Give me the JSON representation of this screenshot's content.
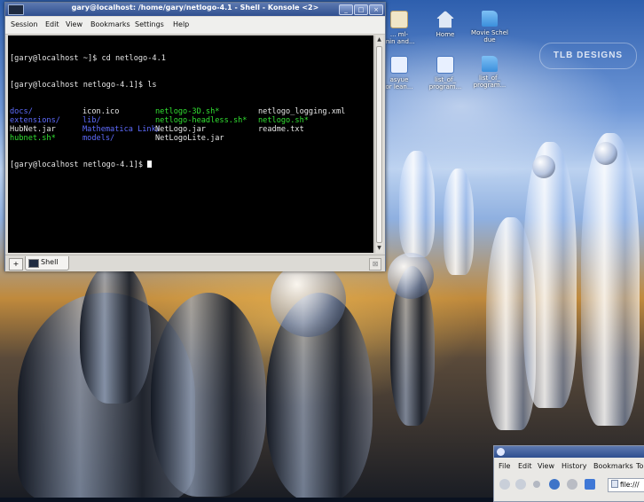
{
  "konsole": {
    "title": "gary@localhost: /home/gary/netlogo-4.1 - Shell - Konsole <2>",
    "window_buttons": [
      "_",
      "□",
      "×"
    ],
    "menu": [
      "Session",
      "Edit",
      "View",
      "Bookmarks",
      "Settings",
      "Help"
    ],
    "terminal": {
      "lines": [
        "[gary@localhost ~]$ cd netlogo-4.1",
        "[gary@localhost netlogo-4.1]$ ls"
      ],
      "listing": [
        [
          {
            "text": "docs/",
            "type": "dir"
          },
          {
            "text": "icon.ico",
            "type": "file"
          },
          {
            "text": "netlogo-3D.sh*",
            "type": "exe"
          },
          {
            "text": "netlogo_logging.xml",
            "type": "file"
          }
        ],
        [
          {
            "text": "extensions/",
            "type": "dir"
          },
          {
            "text": "lib/",
            "type": "dir"
          },
          {
            "text": "netlogo-headless.sh*",
            "type": "exe"
          },
          {
            "text": "netlogo.sh*",
            "type": "exe"
          }
        ],
        [
          {
            "text": "HubNet.jar",
            "type": "file"
          },
          {
            "text": "Mathematica Link/",
            "type": "dir"
          },
          {
            "text": "NetLogo.jar",
            "type": "file"
          },
          {
            "text": "readme.txt",
            "type": "file"
          }
        ],
        [
          {
            "text": "hubnet.sh*",
            "type": "exe"
          },
          {
            "text": "models/",
            "type": "dir"
          },
          {
            "text": "NetLogoLite.jar",
            "type": "file"
          },
          {
            "text": "",
            "type": "file"
          }
        ]
      ],
      "prompt": "[gary@localhost netlogo-4.1]$ "
    },
    "tab_label": "Shell"
  },
  "desktop": {
    "icons": [
      {
        "label": "... ml-\nmin and..."
      },
      {
        "label": "Home"
      },
      {
        "label": "Movie Schel\ndue"
      },
      {
        "label": "asyue\nor lean..."
      },
      {
        "label": "list_of_\nprogram..."
      },
      {
        "label": "list_of_\nprogram..."
      }
    ],
    "watermark": "TLB DESIGNS"
  },
  "browser": {
    "menu": [
      "File",
      "Edit",
      "View",
      "History",
      "Bookmarks",
      "To"
    ],
    "url": "file:///"
  },
  "colors": {
    "dir": "#5f6cff",
    "exe": "#32e032",
    "file": "#e6e6e6",
    "titlebar": "#2f4f8f"
  }
}
